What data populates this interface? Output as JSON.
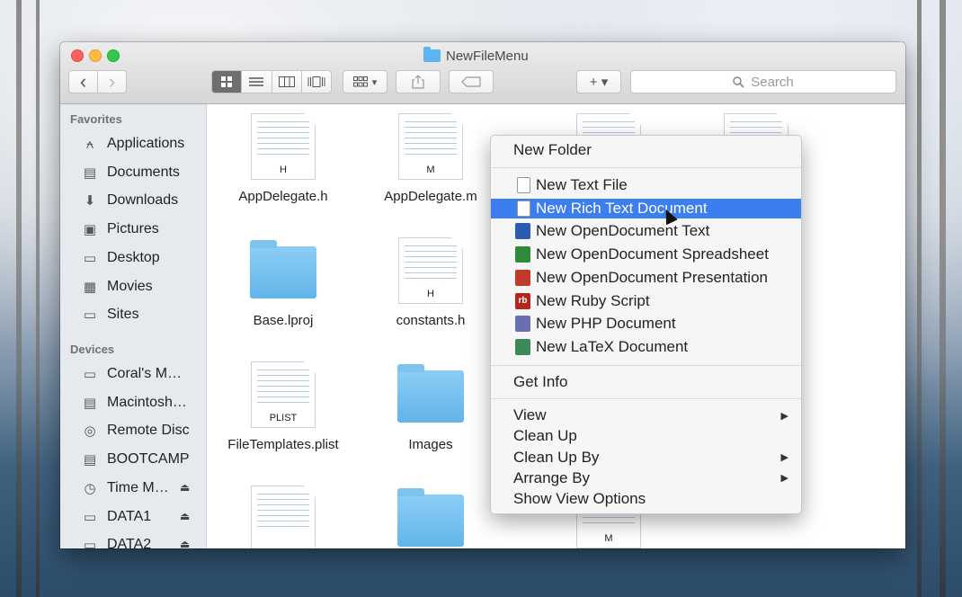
{
  "window": {
    "title": "NewFileMenu"
  },
  "toolbar": {
    "back_glyph": "‹",
    "forward_glyph": "›",
    "views": [
      "icon-view",
      "list-view",
      "column-view",
      "coverflow-view"
    ],
    "arrange_label": "▾",
    "action_label": "+ ▾",
    "search_placeholder": "Search"
  },
  "sidebar": {
    "favorites_header": "Favorites",
    "favorites": [
      {
        "label": "Applications",
        "icon": "applications-icon"
      },
      {
        "label": "Documents",
        "icon": "documents-icon"
      },
      {
        "label": "Downloads",
        "icon": "downloads-icon"
      },
      {
        "label": "Pictures",
        "icon": "pictures-icon"
      },
      {
        "label": "Desktop",
        "icon": "desktop-icon"
      },
      {
        "label": "Movies",
        "icon": "movies-icon"
      },
      {
        "label": "Sites",
        "icon": "folder-icon"
      }
    ],
    "devices_header": "Devices",
    "devices": [
      {
        "label": "Coral's M…",
        "icon": "laptop-icon"
      },
      {
        "label": "Macintosh…",
        "icon": "disk-icon"
      },
      {
        "label": "Remote Disc",
        "icon": "disc-icon"
      },
      {
        "label": "BOOTCAMP",
        "icon": "disk-icon"
      },
      {
        "label": "Time M…",
        "icon": "time-machine-icon"
      },
      {
        "label": "DATA1",
        "icon": "drive-icon"
      },
      {
        "label": "DATA2",
        "icon": "drive-icon"
      }
    ],
    "eject_glyph": "⏏"
  },
  "files": [
    {
      "name": "AppDelegate.h",
      "kind": "doc",
      "ext": "H"
    },
    {
      "name": "AppDelegate.m",
      "kind": "doc",
      "ext": "M"
    },
    {
      "name": "Base.lproj",
      "kind": "folder",
      "ext": ""
    },
    {
      "name": "constants.h",
      "kind": "doc",
      "ext": "H"
    },
    {
      "name": "FileTemplates.plist",
      "kind": "doc",
      "ext": "PLIST"
    },
    {
      "name": "Images",
      "kind": "folder",
      "ext": ""
    }
  ],
  "bottom_doc_ext": "M",
  "context_menu": {
    "new_folder": "New Folder",
    "new_items": [
      {
        "label": "New Text File",
        "icon": "text-file-icon",
        "color": "#ffffff",
        "glyph": ""
      },
      {
        "label": "New Rich Text Document",
        "icon": "rtf-icon",
        "color": "#ffffff",
        "glyph": ""
      },
      {
        "label": "New OpenDocument Text",
        "icon": "odt-icon",
        "color": "#2a5db0",
        "glyph": ""
      },
      {
        "label": "New OpenDocument Spreadsheet",
        "icon": "ods-icon",
        "color": "#2e8b3a",
        "glyph": ""
      },
      {
        "label": "New OpenDocument Presentation",
        "icon": "odp-icon",
        "color": "#c0392b",
        "glyph": ""
      },
      {
        "label": "New Ruby Script",
        "icon": "ruby-icon",
        "color": "#b3261e",
        "glyph": "rb"
      },
      {
        "label": "New PHP Document",
        "icon": "php-icon",
        "color": "#6a6fb0",
        "glyph": ""
      },
      {
        "label": "New LaTeX Document",
        "icon": "latex-icon",
        "color": "#3b8a57",
        "glyph": ""
      }
    ],
    "highlighted_index": 1,
    "get_info": "Get Info",
    "view_items": [
      {
        "label": "View",
        "submenu": true
      },
      {
        "label": "Clean Up",
        "submenu": false
      },
      {
        "label": "Clean Up By",
        "submenu": true
      },
      {
        "label": "Arrange By",
        "submenu": true
      },
      {
        "label": "Show View Options",
        "submenu": false
      }
    ],
    "submenu_glyph": "▶"
  },
  "colors": {
    "highlight": "#3c7df0",
    "folder": "#62b5ea",
    "sidebar_bg": "#e6eaef"
  }
}
